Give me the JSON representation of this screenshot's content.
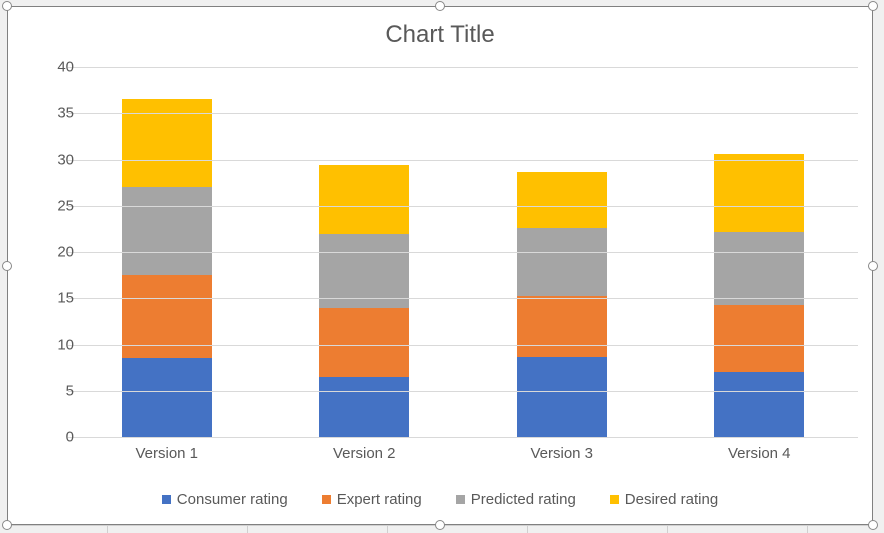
{
  "chart_data": {
    "type": "bar-stacked",
    "title": "Chart Title",
    "xlabel": "",
    "ylabel": "",
    "ylim": [
      0,
      40
    ],
    "ytick_step": 5,
    "categories": [
      "Version 1",
      "Version 2",
      "Version 3",
      "Version 4"
    ],
    "series": [
      {
        "name": "Consumer rating",
        "color": "#4472C4",
        "values": [
          8.5,
          6.5,
          8.7,
          7.0
        ]
      },
      {
        "name": "Expert rating",
        "color": "#ED7D31",
        "values": [
          9.0,
          7.5,
          6.5,
          7.3
        ]
      },
      {
        "name": "Predicted rating",
        "color": "#A5A5A5",
        "values": [
          9.5,
          7.9,
          7.4,
          7.9
        ]
      },
      {
        "name": "Desired rating",
        "color": "#FFC000",
        "values": [
          9.5,
          7.5,
          6.0,
          8.4
        ]
      }
    ],
    "legend_position": "bottom",
    "grid": true
  }
}
